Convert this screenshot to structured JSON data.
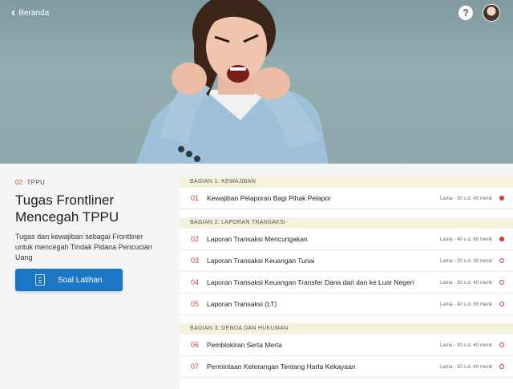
{
  "header": {
    "back_label": "Beranda",
    "help_label": "?"
  },
  "lesson": {
    "number": "02",
    "category": "TPPU",
    "title": "Tugas Frontliner Mencegah TPPU",
    "description": "Tugas dan kewajiban sebagai Frontliner untuk mencegah Tindak Pidana Pencucian Uang",
    "practice_button": "Soal Latihan"
  },
  "sections": [
    {
      "label": "BAGIAN 1: KEWAJIBAN",
      "items": [
        {
          "num": "01",
          "title": "Kewajiban Pelaporan Bagi Pihak Pelapor",
          "duration": "Lama - 30 s.d. 40 menit",
          "status": "filled"
        }
      ]
    },
    {
      "label": "BAGIAN 2: LAPORAN TRANSAKSI",
      "items": [
        {
          "num": "02",
          "title": "Laporan Transaksi Mencurigakan",
          "duration": "Lama - 40 s.d. 60 menit",
          "status": "filled"
        },
        {
          "num": "03",
          "title": "Laporan Transaksi Keuangan Tunai",
          "duration": "Lama - 20 s.d. 30 menit",
          "status": "open"
        },
        {
          "num": "04",
          "title": "Laporan Transaksi Keuangan Transfer Dana dari dan ke Luar Negeri",
          "duration": "Lama - 30 s.d. 40 menit",
          "status": "open"
        },
        {
          "num": "05",
          "title": "Laporan Transaksi (LT)",
          "duration": "Lama - 40 s.d. 60 menit",
          "status": "open"
        }
      ]
    },
    {
      "label": "BAGIAN 3: DENDA DAN HUKUMAN",
      "items": [
        {
          "num": "06",
          "title": "Pemblokiran Serta Merta",
          "duration": "Lama - 30 s.d. 40 menit",
          "status": "open"
        },
        {
          "num": "07",
          "title": "Permintaan Keterangan Tentang Harta Kekayaan",
          "duration": "Lama - 30 s.d. 40 menit",
          "status": "open"
        }
      ]
    }
  ]
}
